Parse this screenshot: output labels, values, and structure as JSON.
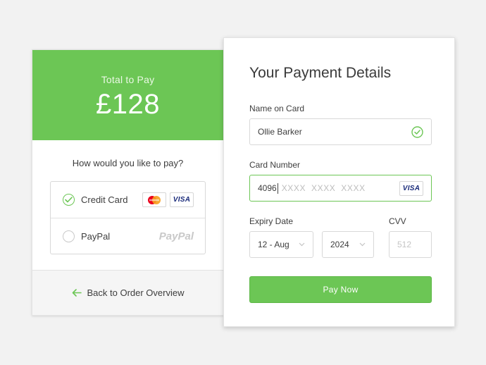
{
  "summary": {
    "total_label": "Total to Pay",
    "total_amount": "£128",
    "question": "How would you like to pay?",
    "methods": [
      {
        "label": "Credit Card",
        "selected": true,
        "logos": [
          "mastercard-icon",
          "visa-icon"
        ],
        "visa_text": "VISA"
      },
      {
        "label": "PayPal",
        "selected": false,
        "logo_text": "PayPal"
      }
    ],
    "back_label": "Back to Order Overview"
  },
  "form": {
    "title": "Your Payment Details",
    "name_label": "Name on Card",
    "name_value": "Ollie Barker",
    "card_label": "Card Number",
    "card_value": "4096",
    "card_placeholder": "XXXX  XXXX  XXXX",
    "card_brand": "VISA",
    "expiry_label": "Expiry Date",
    "expiry_month": "12 - Aug",
    "expiry_year": "2024",
    "cvv_label": "CVV",
    "cvv_placeholder": "512",
    "pay_label": "Pay Now"
  },
  "colors": {
    "accent": "#6cc655",
    "background": "#f2f2f2",
    "visa_blue": "#1a2b7a"
  }
}
